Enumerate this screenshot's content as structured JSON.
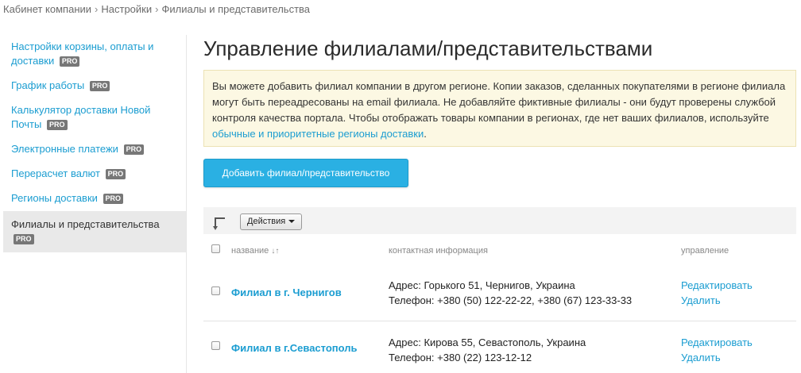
{
  "breadcrumb": {
    "items": [
      "Кабинет компании",
      "Настройки",
      "Филиалы и представительства"
    ],
    "separator": "›"
  },
  "sidebar": {
    "items": [
      {
        "label": "Настройки корзины, оплаты и доставки",
        "badge": "PRO"
      },
      {
        "label": "График работы",
        "badge": "PRO"
      },
      {
        "label": "Калькулятор доставки Новой Почты",
        "badge": "PRO"
      },
      {
        "label": "Электронные платежи",
        "badge": "PRO"
      },
      {
        "label": "Перерасчет валют",
        "badge": "PRO"
      },
      {
        "label": "Регионы доставки",
        "badge": "PRO"
      },
      {
        "label": "Филиалы и представительства",
        "badge": "PRO",
        "active": true
      }
    ]
  },
  "main": {
    "title": "Управление филиалами/представительствами",
    "notice": {
      "text": "Вы можете добавить филиал компании в другом регионе. Копии заказов, сделанных покупателями в регионе филиала могут быть переадресованы на email филиала. Не добавляйте фиктивные филиалы - они будут проверены службой контроля качества портала. Чтобы отображать товары компании в регионах, где нет ваших филиалов, используйте ",
      "link": "обычные и приоритетные регионы доставки",
      "suffix": "."
    },
    "add_button": "Добавить филиал/представительство",
    "actions_button": "Действия",
    "table": {
      "headers": {
        "name": "название",
        "sort_glyph": "↓↑",
        "contact": "контактная информация",
        "manage": "управление"
      },
      "rows": [
        {
          "name": "Филиал в г. Чернигов",
          "address": "Адрес: Горького 51, Чернигов, Украина",
          "phone": "Телефон: +380 (50) 122-22-22, +380 (67) 123-33-33",
          "edit": "Редактировать",
          "delete": "Удалить"
        },
        {
          "name": "Филиал в г.Севастополь",
          "address": "Адрес: Кирова 55, Севастополь, Украина",
          "phone": "Телефон: +380 (22) 123-12-12",
          "edit": "Редактировать",
          "delete": "Удалить"
        }
      ]
    }
  },
  "colors": {
    "link": "#1b9dd1",
    "button": "#2ab0e3",
    "notice_bg": "#fcf8e3",
    "badge": "#777777"
  }
}
